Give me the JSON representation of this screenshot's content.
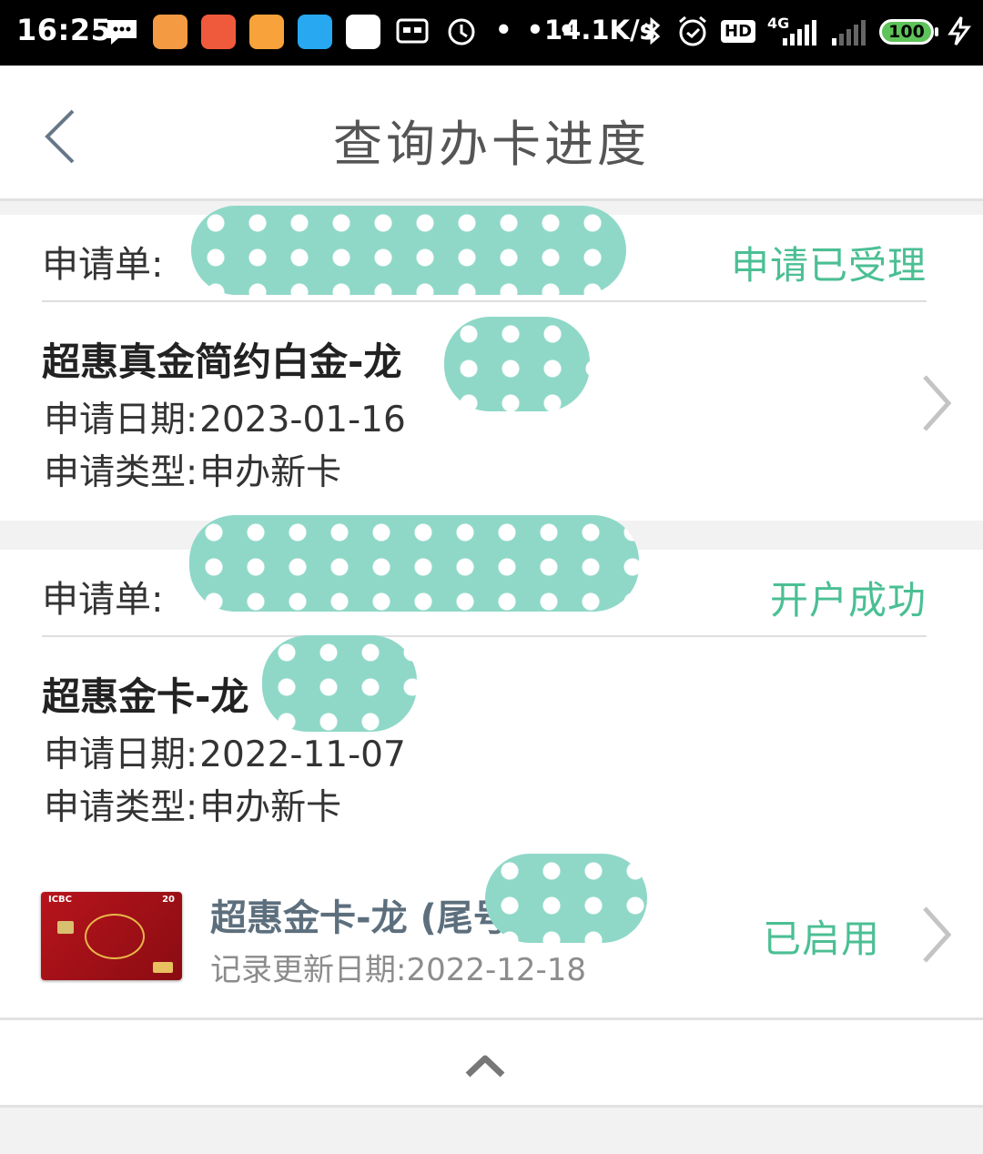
{
  "status_bar": {
    "time": "16:25",
    "net_speed": "14.1K/s",
    "network_type": "4G",
    "hd_badge": "HD",
    "battery": "100",
    "more": "• • •"
  },
  "header": {
    "title": "查询办卡进度",
    "back_icon": "chevron-left-icon"
  },
  "applications": [
    {
      "order_label": "申请单:",
      "status": "申请已受理",
      "card_name": "超惠真金简约白金-龙",
      "date_label": "申请日期:",
      "date": "2023-01-16",
      "type_label": "申请类型:",
      "type": "申办新卡"
    },
    {
      "order_label": "申请单:",
      "status": "开户成功",
      "card_name": "超惠金卡-龙",
      "date_label": "申请日期:",
      "date": "2022-11-07",
      "type_label": "申请类型:",
      "type": "申办新卡"
    }
  ],
  "issued_card": {
    "name": "超惠金卡-龙 (尾号",
    "update_label": "记录更新日期:",
    "update_date": "2022-12-18",
    "status": "已启用",
    "card_art_text": "ICBC",
    "card_art_number": "20"
  },
  "colors": {
    "accent_green": "#4bbf94",
    "redaction": "#8fd8c8",
    "status_bar_bg": "#000000"
  },
  "icons": {
    "collapse": "chevron-up-icon",
    "row_arrow": "chevron-right-icon"
  }
}
